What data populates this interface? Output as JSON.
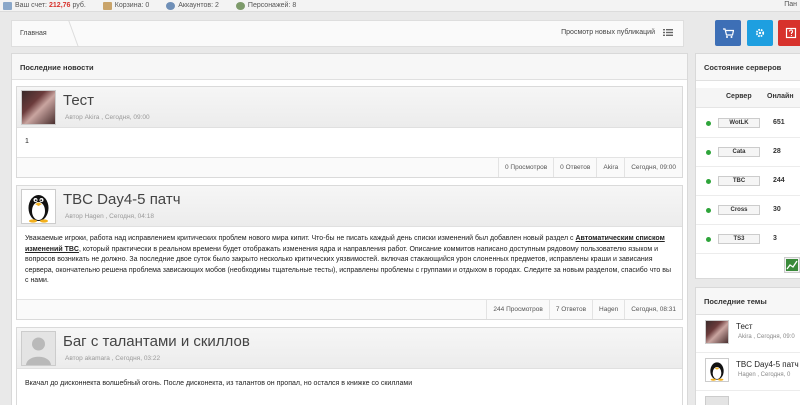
{
  "topbar": {
    "account_label": "Ваш счет:",
    "account_value": "212,76",
    "account_currency": "руб.",
    "cart": "Корзина: 0",
    "accounts": "Аккаунтов: 2",
    "characters": "Персонажей: 8",
    "right_label": "Пан"
  },
  "breadcrumb": {
    "home": "Главная",
    "new_publications": "Просмотр новых публикаций"
  },
  "buttons": {
    "accent_blue": "#3d6fb6",
    "accent_red": "#d7322c"
  },
  "news": {
    "heading": "Последние новости",
    "posts": [
      {
        "title": "Тест",
        "meta": "Автор  Akira  , Сегодня, 09:00",
        "body": "1",
        "views": "0 Просмотров",
        "replies": "0 Ответов",
        "author": "Akira",
        "time": "Сегодня, 09:00",
        "avatar_icon": "anime-girl-avatar"
      },
      {
        "title": "TBC Day4-5 патч",
        "meta": "Автор  Hagen  , Сегодня, 04:18",
        "body_before": "Уважаемые игроки, работа над исправлением критических проблем нового мира кипит. Что-бы не писать каждый день списки изменений был добавлен новый раздел с ",
        "body_link": "Автоматическим списком изменений TBC",
        "body_after": ", который практически в реальном времени будет отображать изменения ядра и направления работ. Описание коммитов написано доступным рядовому пользователю языком и вопросов возникать не должно. За последние двое суток было закрыто несколько критических уязвимостей. включая стакающийся урон слоненных предметов, исправлены краши и зависания сервера, окончательно решена проблема зависающих мобов (необходимы тщательные тесты), исправлены проблемы с группами и отдыхом в городах. Следите за новым разделом, спасибо что вы с нами.",
        "views": "244 Просмотров",
        "replies": "7 Ответов",
        "author": "Hagen",
        "time": "Сегодня, 08:31",
        "avatar_icon": "penguin-avatar"
      },
      {
        "title": "Баг с талантами и скиллов",
        "meta": "Автор  akamara  , Сегодня, 03:22",
        "body": "Вкачал до дисконнекта волшебный огонь. После дисконекта, из талантов он пропал, но остался в книжке со скиллами",
        "avatar_icon": "default-user-avatar"
      }
    ]
  },
  "servers": {
    "heading": "Состояние серверов",
    "col_server": "Сервер",
    "col_online": "Онлайн",
    "rows": [
      {
        "name": "WotLK",
        "online": "651"
      },
      {
        "name": "Cata",
        "online": "28"
      },
      {
        "name": "TBC",
        "online": "244"
      },
      {
        "name": "Cross",
        "online": "30"
      },
      {
        "name": "TS3",
        "online": "3"
      }
    ]
  },
  "topics": {
    "heading": "Последние темы",
    "rows": [
      {
        "title": "Тест",
        "meta": "Akira , Сегодня, 09:0"
      },
      {
        "title": "TBC Day4-5 патч",
        "meta": "Hagen , Сегодня, 0"
      }
    ]
  }
}
